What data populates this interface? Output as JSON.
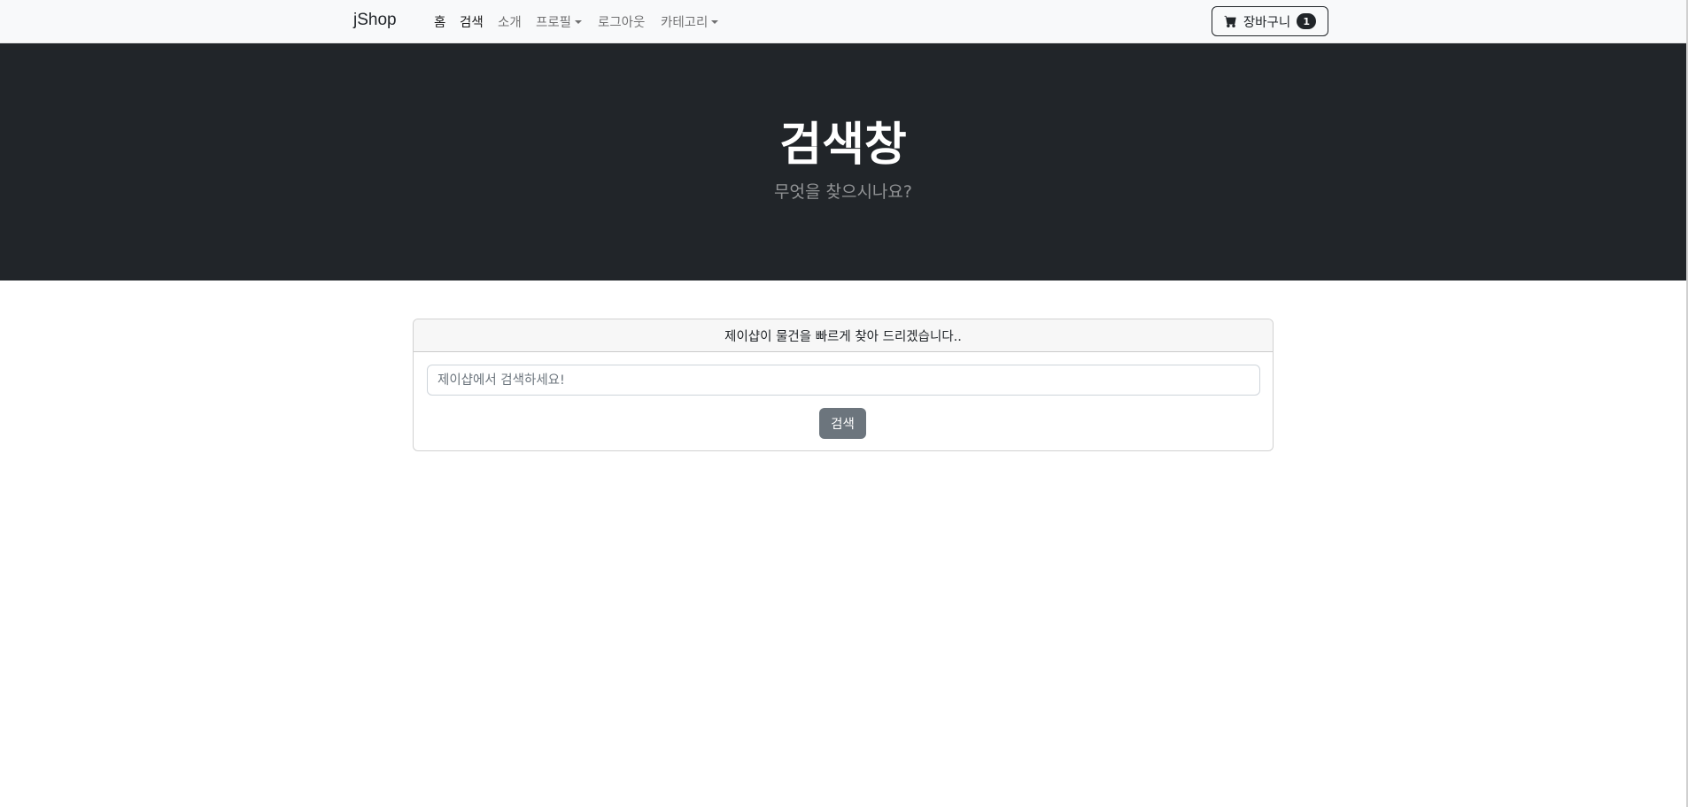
{
  "navbar": {
    "brand": "jShop",
    "links": [
      {
        "label": "홈",
        "active": true
      },
      {
        "label": "검색",
        "active": true
      },
      {
        "label": "소개",
        "active": false
      },
      {
        "label": "프로필",
        "active": false,
        "dropdown": true
      },
      {
        "label": "로그아웃",
        "active": false
      },
      {
        "label": "카테고리",
        "active": false,
        "dropdown": true
      }
    ],
    "cart": {
      "label": "장바구니",
      "count": "1",
      "icon": "cart-icon"
    }
  },
  "hero": {
    "title": "검색창",
    "subtitle": "무엇을 찾으시나요?"
  },
  "search_card": {
    "header": "제이샵이 물건을 빠르게 찾아 드리겠습니다..",
    "input_value": "",
    "input_placeholder": "제이샵에서 검색하세요!",
    "button_label": "검색"
  },
  "colors": {
    "navbar_bg": "#f8f9fa",
    "hero_bg": "#212529",
    "button_secondary": "#6c757d"
  }
}
